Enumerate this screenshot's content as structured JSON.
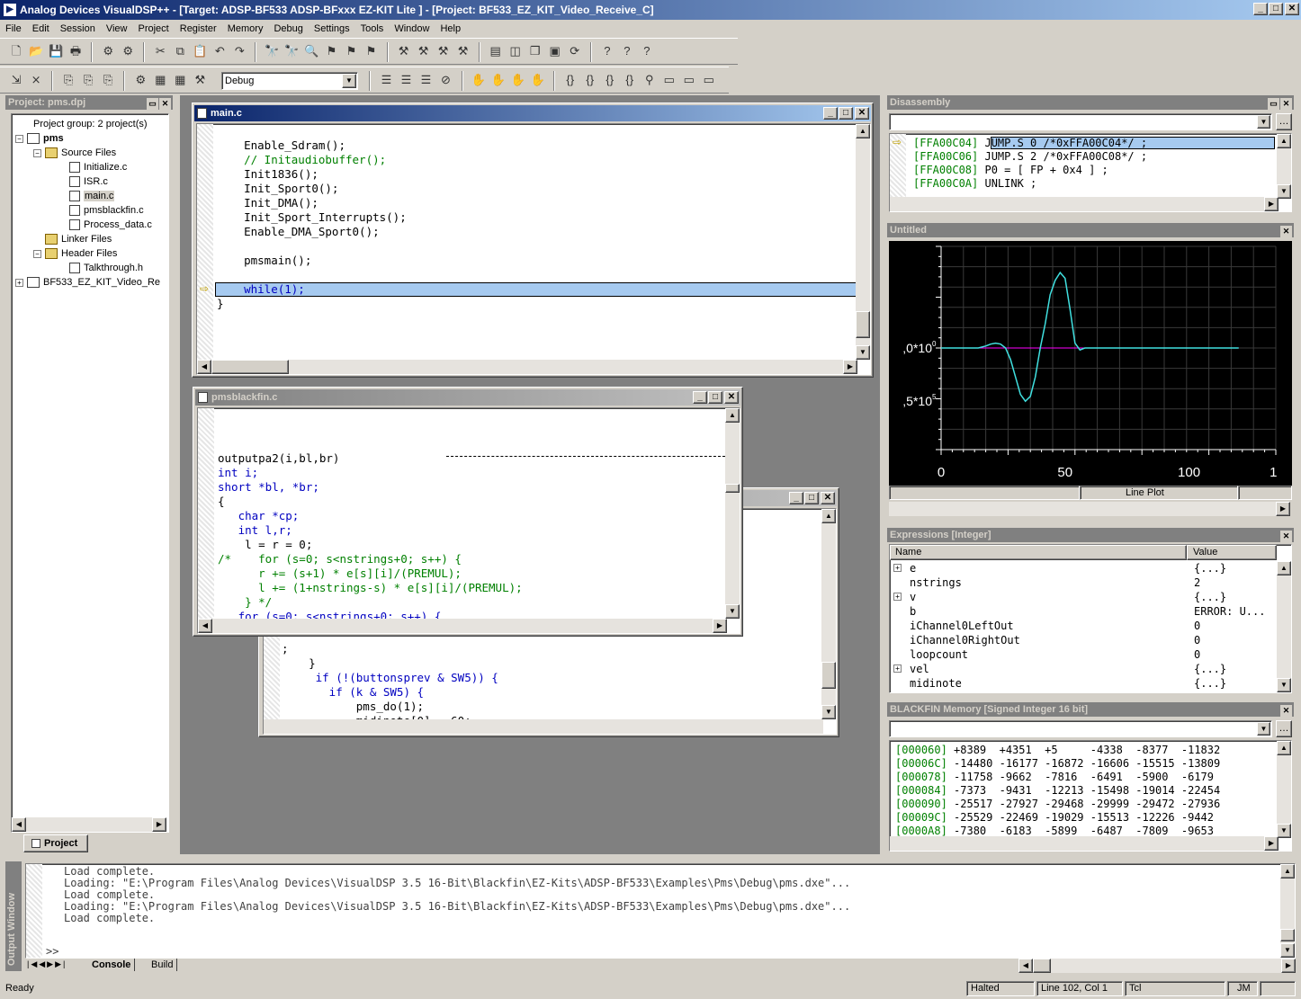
{
  "app": {
    "title": "Analog Devices VisualDSP++ - [Target: ADSP-BF533 ADSP-BFxxx EZ-KIT Lite ] - [Project: BF533_EZ_KIT_Video_Receive_C]"
  },
  "menu": [
    "File",
    "Edit",
    "Session",
    "View",
    "Project",
    "Register",
    "Memory",
    "Debug",
    "Settings",
    "Tools",
    "Window",
    "Help"
  ],
  "toolbar": {
    "config_value": "Debug"
  },
  "project_pane": {
    "title": "Project: pms.dpj",
    "group": "Project group: 2 project(s)",
    "project": "pms",
    "source_folder": "Source Files",
    "source_files": [
      "Initialize.c",
      "ISR.c",
      "main.c",
      "pmsblackfin.c",
      "Process_data.c"
    ],
    "linker_folder": "Linker Files",
    "header_folder": "Header Files",
    "header_files": [
      "Talkthrough.h"
    ],
    "other_project": "BF533_EZ_KIT_Video_Re",
    "tab": "Project"
  },
  "main_c": {
    "title": "main.c",
    "lines": [
      {
        "t": "    Enable_Sdram();",
        "c": ""
      },
      {
        "t": "    // Initaudiobuffer();",
        "c": "cm"
      },
      {
        "t": "    Init1836();",
        "c": ""
      },
      {
        "t": "    Init_Sport0();",
        "c": ""
      },
      {
        "t": "    Init_DMA();",
        "c": ""
      },
      {
        "t": "    Init_Sport_Interrupts();",
        "c": ""
      },
      {
        "t": "    Enable_DMA_Sport0();",
        "c": ""
      },
      {
        "t": "",
        "c": ""
      },
      {
        "t": "    pmsmain();",
        "c": ""
      },
      {
        "t": "",
        "c": ""
      },
      {
        "t": "    while(1);",
        "c": "kw"
      },
      {
        "t": "}",
        "c": ""
      }
    ]
  },
  "pmsblackfin_c": {
    "title": "pmsblackfin.c",
    "lines": [
      {
        "t": "",
        "c": ""
      },
      {
        "t": "",
        "c": ""
      },
      {
        "t": "outputpa2(i,bl,br)",
        "c": ""
      },
      {
        "t": "int i;",
        "c": "kw"
      },
      {
        "t": "short *bl, *br;",
        "c": "kw"
      },
      {
        "t": "{",
        "c": ""
      },
      {
        "t": "   char *cp;",
        "c": "kw"
      },
      {
        "t": "   int l,r;",
        "c": "kw"
      },
      {
        "t": "    l = r = 0;",
        "c": ""
      },
      {
        "t": "/*    for (s=0; s<nstrings+0; s++) {",
        "c": "cm"
      },
      {
        "t": "      r += (s+1) * e[s][i]/(PREMUL);",
        "c": "cm"
      },
      {
        "t": "      l += (1+nstrings-s) * e[s][i]/(PREMUL);",
        "c": "cm"
      },
      {
        "t": "    } */",
        "c": "cm"
      },
      {
        "t": "   for (s=0; s<nstrings+0; s++) {",
        "c": "kw"
      }
    ]
  },
  "third_window": {
    "lines": [
      {
        "t": ";",
        "c": ""
      },
      {
        "t": "    }",
        "c": ""
      },
      {
        "t": "     if (!(buttonsprev & SW5)) {",
        "c": "kw"
      },
      {
        "t": "       if (k & SW5) {",
        "c": "kw"
      },
      {
        "t": "           pms_do(1);",
        "c": ""
      },
      {
        "t": "           midinote[0] = 60;",
        "c": ""
      }
    ]
  },
  "disassembly": {
    "title": "Disassembly",
    "rows": [
      {
        "addr": "[FFA00C04]",
        "code": "JUMP.S 0 /*0xFFA00C04*/ ;"
      },
      {
        "addr": "[FFA00C06]",
        "code": "JUMP.S 2 /*0xFFA00C08*/ ;"
      },
      {
        "addr": "[FFA00C08]",
        "code": "P0 = [ FP + 0x4 ] ;"
      },
      {
        "addr": "[FFA00C0A]",
        "code": "UNLINK ;"
      }
    ]
  },
  "plot": {
    "title": "Untitled",
    "y_tick_labels": [
      ",0*10",
      ",5*10"
    ],
    "y_tick_exps": [
      "0",
      "5"
    ],
    "x_tick_labels": [
      "0",
      "50",
      "100",
      "1"
    ],
    "status": "Line Plot",
    "line_color": "#40e0e0",
    "zero_color": "#ff00ff"
  },
  "chart_data": {
    "type": "line",
    "x": [
      0,
      5,
      10,
      15,
      18,
      20,
      22,
      24,
      26,
      28,
      30,
      32,
      34,
      36,
      38,
      40,
      42,
      44,
      46,
      48,
      50,
      52,
      54,
      56,
      58,
      60,
      65,
      70,
      80,
      100,
      120
    ],
    "series": [
      {
        "values": [
          0,
          0,
          0,
          0,
          0.02,
          0.04,
          0.05,
          0.04,
          0.0,
          -0.12,
          -0.3,
          -0.48,
          -0.55,
          -0.5,
          -0.3,
          0,
          0.25,
          0.55,
          0.7,
          0.78,
          0.72,
          0.4,
          0.05,
          -0.02,
          0,
          0,
          0,
          0,
          0,
          0,
          0
        ]
      }
    ],
    "xlim": [
      0,
      135
    ],
    "ylim": [
      -1.05,
      1.05
    ],
    "grid": true
  },
  "expressions": {
    "title": "Expressions [Integer]",
    "col_name": "Name",
    "col_value": "Value",
    "rows": [
      {
        "name": "e",
        "value": "{...}",
        "exp": true
      },
      {
        "name": "nstrings",
        "value": "2",
        "exp": false
      },
      {
        "name": "v",
        "value": "{...}",
        "exp": true
      },
      {
        "name": "b",
        "value": "ERROR: U...",
        "exp": false
      },
      {
        "name": "iChannel0LeftOut",
        "value": "0",
        "exp": false
      },
      {
        "name": "iChannel0RightOut",
        "value": "0",
        "exp": false
      },
      {
        "name": "loopcount",
        "value": "0",
        "exp": false
      },
      {
        "name": "vel",
        "value": "{...}",
        "exp": true
      },
      {
        "name": "midinote",
        "value": "{...}",
        "exp": false
      }
    ]
  },
  "memory": {
    "title": "BLACKFIN Memory [Signed Integer 16 bit]",
    "rows": [
      {
        "addr": "[000060]",
        "vals": "+8389  +4351  +5     -4338  -8377  -11832"
      },
      {
        "addr": "[00006C]",
        "vals": "-14480 -16177 -16872 -16606 -15515 -13809"
      },
      {
        "addr": "[000078]",
        "vals": "-11758 -9662  -7816  -6491  -5900  -6179"
      },
      {
        "addr": "[000084]",
        "vals": "-7373  -9431  -12213 -15498 -19014 -22454"
      },
      {
        "addr": "[000090]",
        "vals": "-25517 -27927 -29468 -29999 -29472 -27936"
      },
      {
        "addr": "[00009C]",
        "vals": "-25529 -22469 -19029 -15513 -12226 -9442"
      },
      {
        "addr": "[0000A8]",
        "vals": "-7380  -6183  -5899  -6487  -7809  -9653"
      }
    ]
  },
  "output": {
    "side_label": "Output Window",
    "lines": [
      "Load complete.",
      "Loading: \"E:\\Program Files\\Analog Devices\\VisualDSP 3.5 16-Bit\\Blackfin\\EZ-Kits\\ADSP-BF533\\Examples\\Pms\\Debug\\pms.dxe\"...",
      "Load complete.",
      "Loading: \"E:\\Program Files\\Analog Devices\\VisualDSP 3.5 16-Bit\\Blackfin\\EZ-Kits\\ADSP-BF533\\Examples\\Pms\\Debug\\pms.dxe\"...",
      "Load complete."
    ],
    "prompt": ">>",
    "tab_console": "Console",
    "tab_build": "Build"
  },
  "statusbar": {
    "ready": "Ready",
    "state": "Halted",
    "position": "Line 102, Col 1",
    "lang": "Tcl",
    "user": "JM"
  }
}
